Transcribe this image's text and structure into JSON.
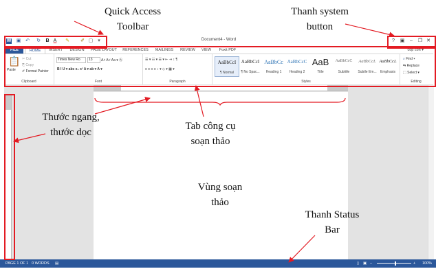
{
  "window": {
    "doc_title": "Document4 - Word"
  },
  "qat": {
    "icons": [
      "word-logo-icon",
      "save-icon",
      "undo-icon",
      "redo-icon",
      "bold-icon",
      "font-color-icon",
      "highlight-icon",
      "format-painter-icon",
      "new-doc-icon",
      "customize-icon"
    ],
    "glyphs": [
      "W",
      "▣",
      "↶",
      "↻",
      "B",
      "A",
      "✎",
      "✐",
      "▢",
      "▾"
    ]
  },
  "system_buttons": {
    "help": "?",
    "ribbon_options": "▣",
    "minimize": "–",
    "restore": "❐",
    "close": "✕"
  },
  "tabs": [
    "FILE",
    "HOME",
    "INSERT",
    "DESIGN",
    "PAGE LAYOUT",
    "REFERENCES",
    "MAILINGS",
    "REVIEW",
    "VIEW",
    "Foxit PDF"
  ],
  "account": "cop con ▾",
  "ribbon": {
    "clipboard": {
      "paste": "Paste",
      "cut": "Cut",
      "copy": "Copy",
      "format_painter": "Format Painter",
      "label": "Clipboard"
    },
    "font": {
      "name": "Times New Ro",
      "size": "13",
      "row1": "A˄ A˅  Aa ▾  Ⓐ",
      "row2": "B  I  U ▾  abc  x₂  x²   A ▾  ab ▾  A ▾",
      "label": "Font"
    },
    "paragraph": {
      "row1": "☰ ▾  ☷ ▾  ☰ ▾   ⇤  ⇥   ↕  ¶",
      "row2": "≡  ≡  ≡  ≡   ↕ ▾   ◇ ▾  ▦ ▾",
      "label": "Paragraph"
    },
    "styles": {
      "items": [
        {
          "sample": "AaBbCcI",
          "name": "¶ Normal"
        },
        {
          "sample": "AaBbCcI",
          "name": "¶ No Spac..."
        },
        {
          "sample": "AaBbCc",
          "name": "Heading 1"
        },
        {
          "sample": "AaBbCcC",
          "name": "Heading 2"
        },
        {
          "sample": "AaB",
          "name": "Title"
        },
        {
          "sample": "AaBbCcC",
          "name": "Subtitle"
        },
        {
          "sample": "AaBbCcL",
          "name": "Subtle Em..."
        },
        {
          "sample": "AaBbCcL",
          "name": "Emphasis"
        }
      ],
      "label": "Styles"
    },
    "editing": {
      "find": "Find ▾",
      "replace": "Replace",
      "select": "Select ▾",
      "label": "Editing"
    }
  },
  "status_bar": {
    "page": "PAGE 1 OF 1",
    "words": "0 WORDS",
    "zoom": "100%"
  },
  "callouts": {
    "quick_access": [
      "Quick Access",
      "Toolbar"
    ],
    "system_button": [
      "Thanh system",
      "button"
    ],
    "rulers": [
      "Thước ngang,",
      "thước dọc"
    ],
    "tab_tools": [
      "Tab công cụ",
      "soạn thảo"
    ],
    "editing_area": [
      "Vùng soạn",
      "thảo"
    ],
    "status_bar": [
      "Thanh Status",
      "Bar"
    ]
  },
  "annotation_color": "#e31b23"
}
